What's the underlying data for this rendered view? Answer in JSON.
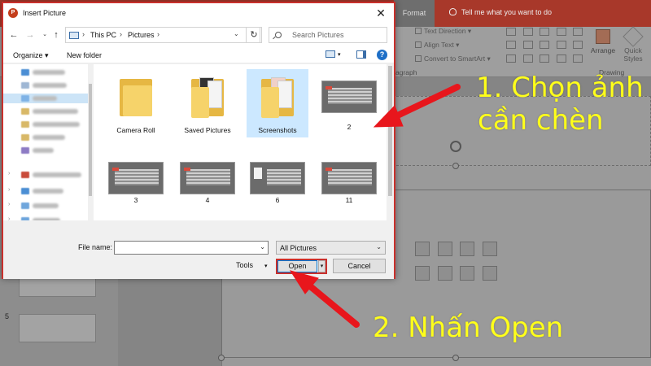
{
  "background_app": {
    "tabs": [
      "Format"
    ],
    "tell_me": "Tell me what you want to do",
    "ribbon": {
      "text_direction": "Text Direction",
      "align_text": "Align Text",
      "convert_smartart": "Convert to SmartArt",
      "paragraph_group": "agraph",
      "arrange": "Arrange",
      "quick_styles_line1": "Quick",
      "quick_styles_line2": "Styles",
      "drawing_group": "Drawing"
    },
    "slide_number": "5"
  },
  "dialog": {
    "title": "Insert Picture",
    "breadcrumb": [
      "This PC",
      "Pictures"
    ],
    "search_placeholder": "Search Pictures",
    "toolbar": {
      "organize": "Organize",
      "new_folder": "New folder"
    },
    "files": [
      {
        "name": "Camera Roll",
        "kind": "folder"
      },
      {
        "name": "Saved Pictures",
        "kind": "folder-docs"
      },
      {
        "name": "Screenshots",
        "kind": "folder-docs",
        "selected": true
      },
      {
        "name": "2",
        "kind": "image"
      },
      {
        "name": "3",
        "kind": "image"
      },
      {
        "name": "4",
        "kind": "image"
      },
      {
        "name": "6",
        "kind": "image"
      },
      {
        "name": "11",
        "kind": "image"
      }
    ],
    "file_name_label": "File name:",
    "file_name_value": "",
    "file_type_filter": "All Pictures",
    "tools_label": "Tools",
    "open_label": "Open",
    "cancel_label": "Cancel"
  },
  "annotations": {
    "step1_line1": "1. Chọn ảnh",
    "step1_line2": "cần chèn",
    "step2": "2. Nhấn Open",
    "color": "#ffff1a",
    "arrow_color": "#e8161c"
  }
}
